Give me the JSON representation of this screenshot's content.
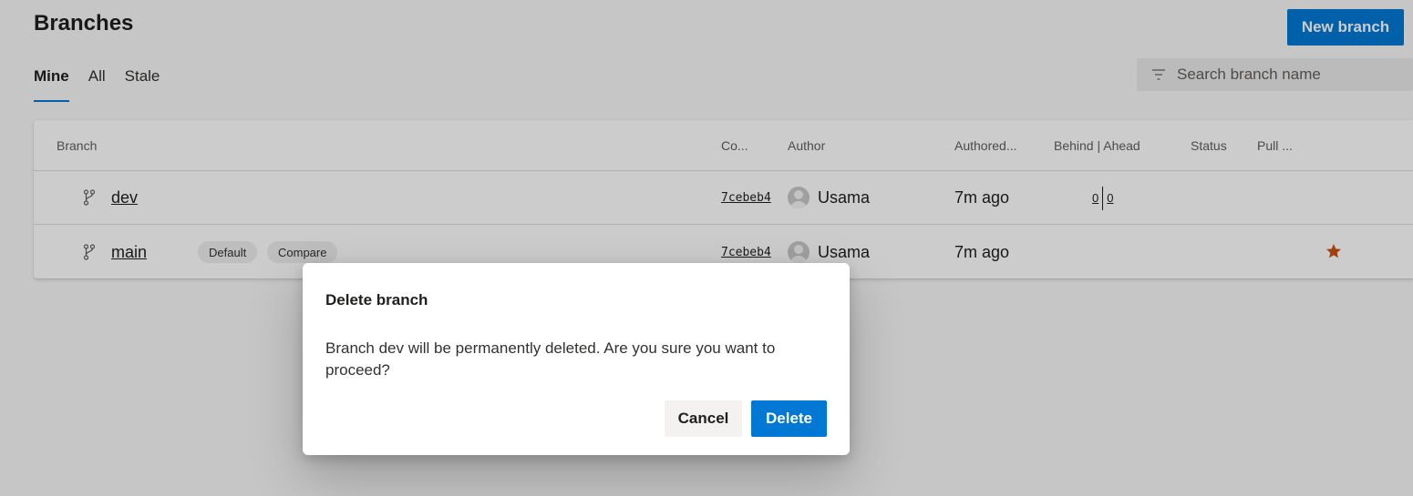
{
  "page": {
    "title": "Branches",
    "new_branch_label": "New branch"
  },
  "tabs": [
    {
      "label": "Mine",
      "active": true
    },
    {
      "label": "All",
      "active": false
    },
    {
      "label": "Stale",
      "active": false
    }
  ],
  "search": {
    "placeholder": "Search branch name",
    "icon": "filter-icon"
  },
  "table": {
    "headers": {
      "branch": "Branch",
      "commit": "Co...",
      "author": "Author",
      "authored": "Authored...",
      "behind_ahead": "Behind | Ahead",
      "status": "Status",
      "pull": "Pull ..."
    },
    "rows": [
      {
        "branch": "dev",
        "commit": "7cebeb4",
        "author": "Usama",
        "authored": "7m ago",
        "behind": "0",
        "ahead": "0"
      },
      {
        "branch": "main",
        "default_label": "Default",
        "compare_label": "Compare",
        "commit": "7cebeb4",
        "author": "Usama",
        "authored": "7m ago",
        "favorite": true
      }
    ]
  },
  "dialog": {
    "title": "Delete branch",
    "message": "Branch dev will be permanently deleted. Are you sure you want to proceed?",
    "cancel_label": "Cancel",
    "delete_label": "Delete"
  },
  "colors": {
    "accent": "#0078d4",
    "star": "#ca5010"
  }
}
